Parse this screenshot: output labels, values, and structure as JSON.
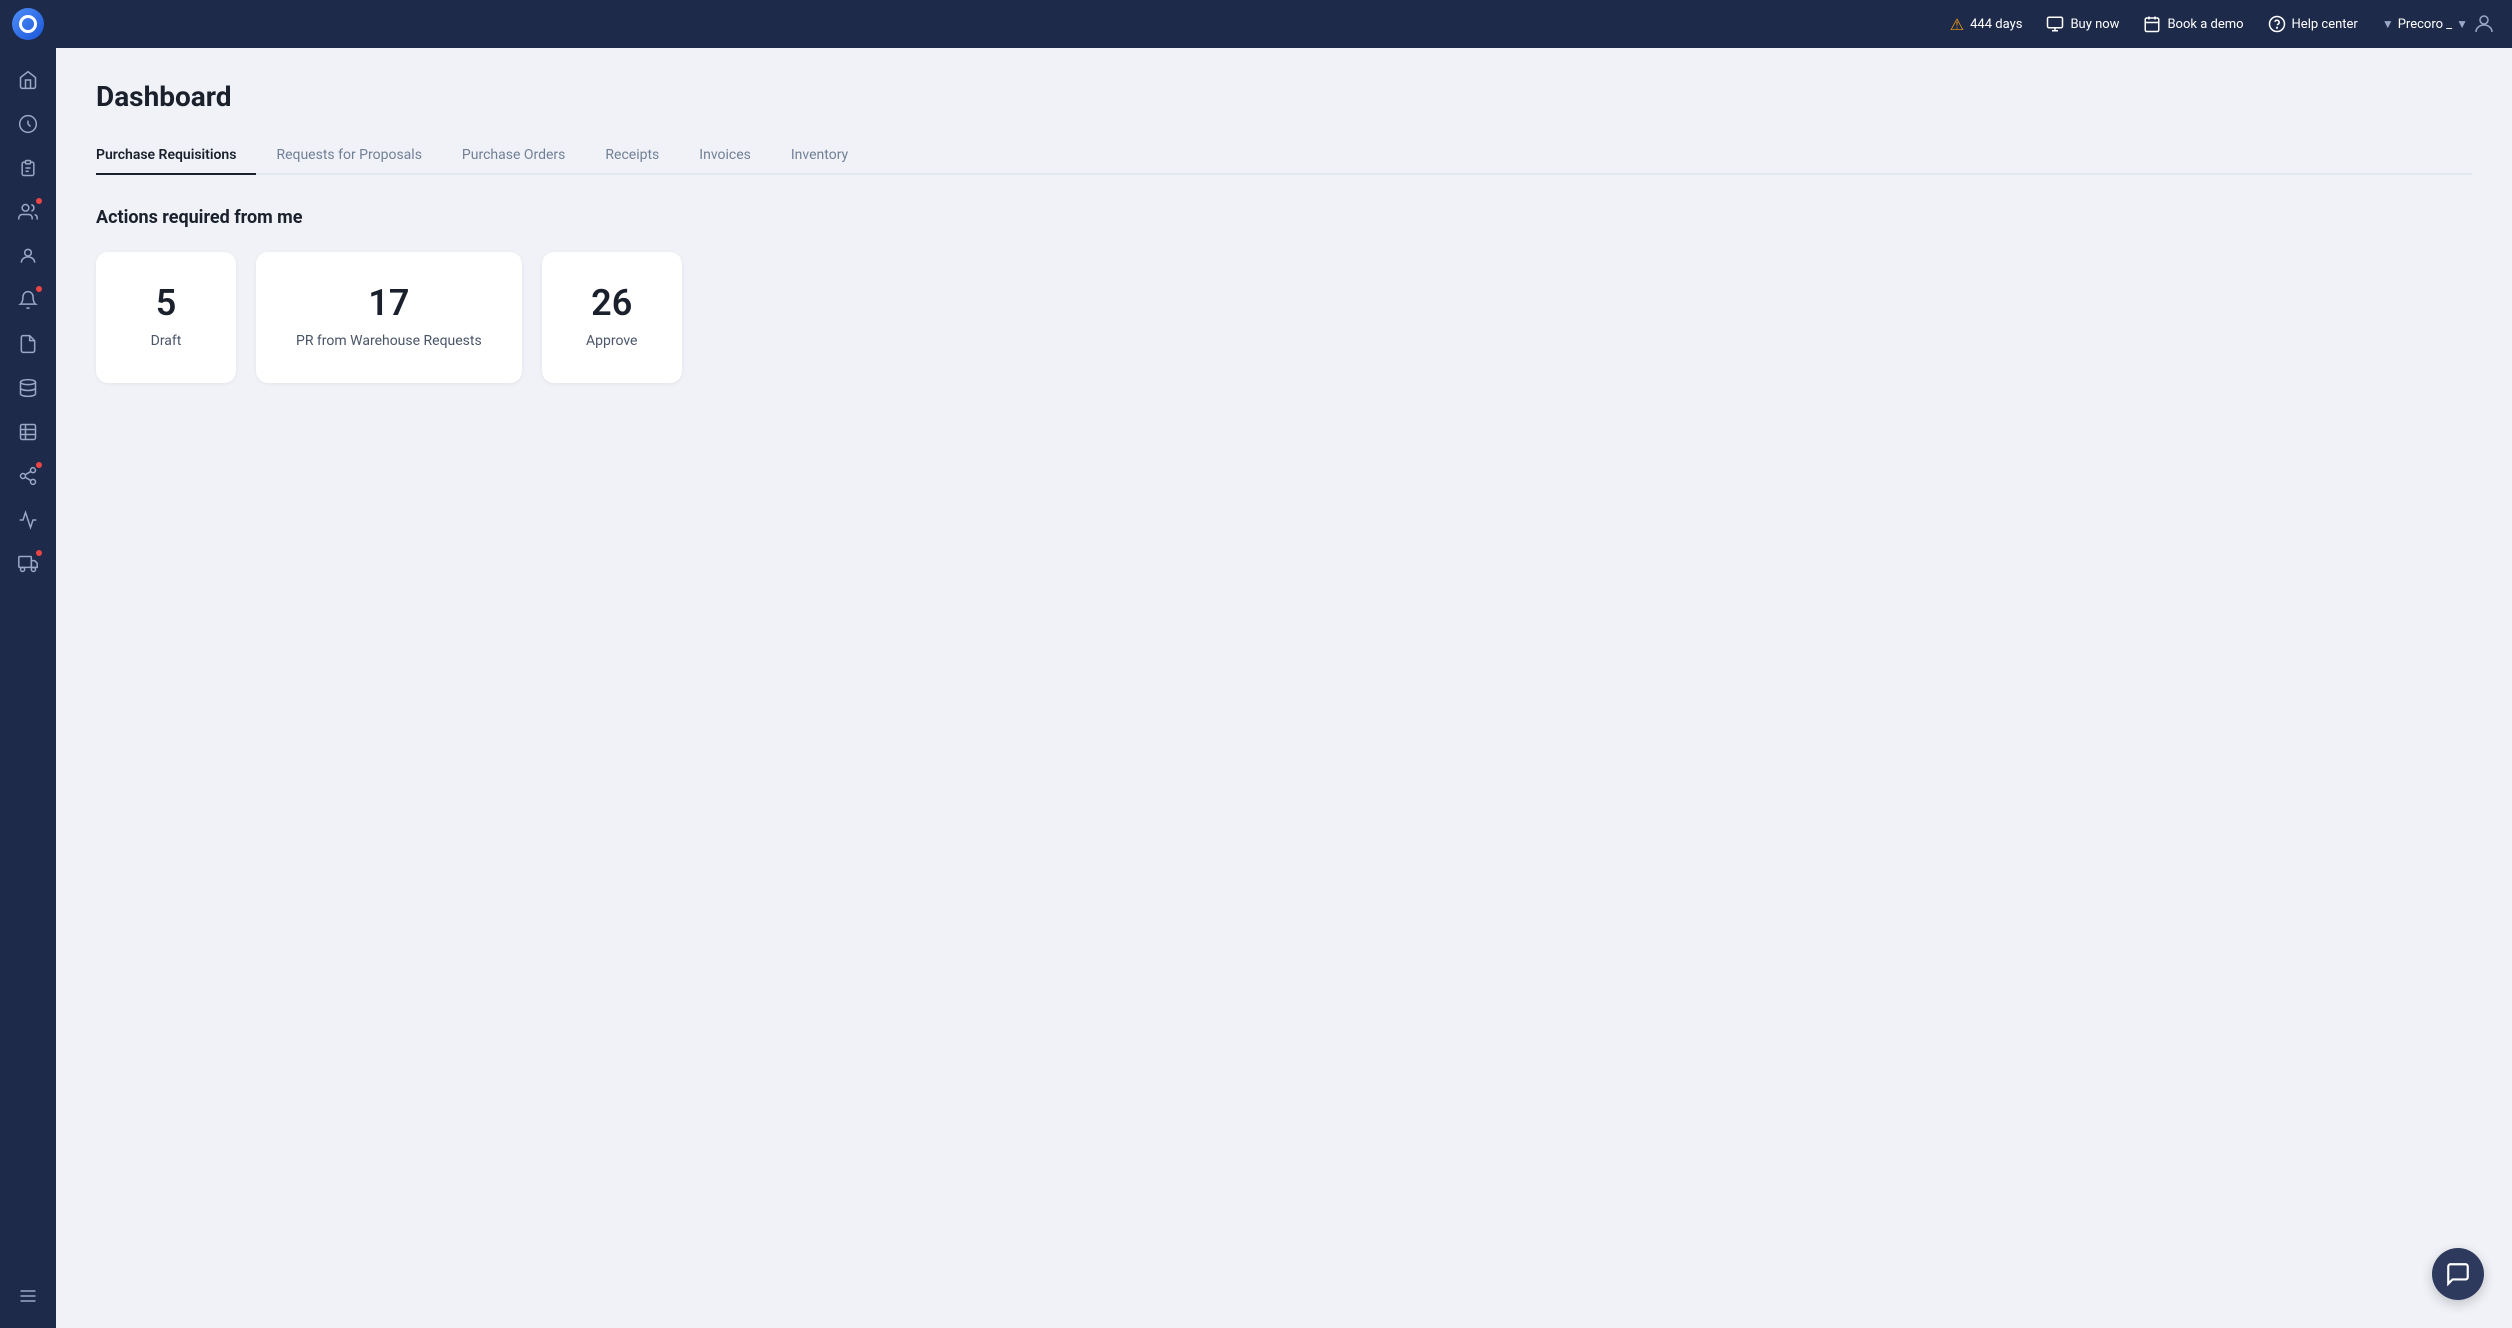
{
  "topnav": {
    "warning_days": "444 days",
    "buy_now": "Buy now",
    "book_demo": "Book a demo",
    "help_center": "Help center",
    "user_name": "Precoro _"
  },
  "sidebar": {
    "items": [
      {
        "name": "home",
        "icon": "🏠"
      },
      {
        "name": "dashboard",
        "icon": "📊"
      },
      {
        "name": "orders",
        "icon": "📋"
      },
      {
        "name": "users-badge",
        "icon": "👥",
        "badge": true
      },
      {
        "name": "team",
        "icon": "👤"
      },
      {
        "name": "notifications-badge",
        "icon": "🔔",
        "badge": true
      },
      {
        "name": "documents",
        "icon": "📄"
      },
      {
        "name": "storage",
        "icon": "🗄"
      },
      {
        "name": "table",
        "icon": "📊"
      },
      {
        "name": "integrations-badge",
        "icon": "🔗",
        "badge": true
      },
      {
        "name": "analytics",
        "icon": "📈"
      },
      {
        "name": "delivery-badge",
        "icon": "🚚",
        "badge": true
      },
      {
        "name": "menu",
        "icon": "☰"
      }
    ]
  },
  "page": {
    "title": "Dashboard"
  },
  "tabs": [
    {
      "label": "Purchase Requisitions",
      "active": true
    },
    {
      "label": "Requests for Proposals",
      "active": false
    },
    {
      "label": "Purchase Orders",
      "active": false
    },
    {
      "label": "Receipts",
      "active": false
    },
    {
      "label": "Invoices",
      "active": false
    },
    {
      "label": "Inventory",
      "active": false
    }
  ],
  "section": {
    "title": "Actions required from me"
  },
  "cards": [
    {
      "number": "5",
      "label": "Draft"
    },
    {
      "number": "17",
      "label": "PR from Warehouse Requests"
    },
    {
      "number": "26",
      "label": "Approve"
    }
  ]
}
